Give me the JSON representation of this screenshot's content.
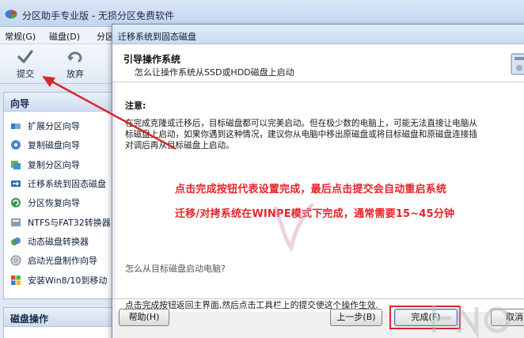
{
  "app": {
    "title": "分区助手专业版 - 无损分区免费软件",
    "menu": [
      "常规(G)",
      "磁盘(D)",
      "分区"
    ],
    "toolbar": {
      "submit_label": "提交",
      "discard_label": "放弃"
    },
    "wizard_panel": {
      "header": "向导",
      "items": [
        {
          "label": "扩展分区向导",
          "icon": "extend-partition-icon"
        },
        {
          "label": "复制磁盘向导",
          "icon": "copy-disk-icon"
        },
        {
          "label": "复制分区向导",
          "icon": "copy-partition-icon"
        },
        {
          "label": "迁移系统到固态磁盘",
          "icon": "migrate-ssd-icon"
        },
        {
          "label": "分区恢复向导",
          "icon": "partition-recovery-icon"
        },
        {
          "label": "NTFS与FAT32转换器",
          "icon": "ntfs-fat32-icon"
        },
        {
          "label": "动态磁盘转换器",
          "icon": "dynamic-disk-icon"
        },
        {
          "label": "启动光盘制作向导",
          "icon": "boot-disc-icon"
        },
        {
          "label": "安装Win8/10到移动",
          "icon": "win-install-icon"
        }
      ]
    },
    "disk_panel": {
      "header": "磁盘操作"
    }
  },
  "dialog": {
    "title": "迁移系统到固态磁盘",
    "heading": "引导操作系统",
    "subheading": "怎么让操作系统从SSD或HDD磁盘上启动",
    "note_label": "注意:",
    "note_lines": [
      "在完成克隆或迁移后，目标磁盘都可以完美启动。但在极少数的电脑上，可能无法直接让电脑从",
      "标磁盘上启动，如果你遇到这种情况，建议你从电脑中移出原磁盘或将目标磁盘和原磁盘连接插",
      "对调后再从目标磁盘上启动。"
    ],
    "annotation_1": "点击完成按钮代表设置完成，最后点击提交会自动重启系统",
    "annotation_2": "迁移/对拷系统在WINPE模式下完成，通常需要15~45分钟",
    "question": "怎么从目标磁盘启动电脑?",
    "final_note": "点击完成按钮返回主界面,然后点击工具栏上的提交使这个操作生效.",
    "buttons": {
      "help": "帮助(H)",
      "back": "上一步(B)",
      "finish": "完成(F)",
      "cancel": "取消"
    }
  },
  "colors": {
    "annotation": "#e8232a",
    "highlight": "#e0232a",
    "title_bar": "#c9daef"
  }
}
